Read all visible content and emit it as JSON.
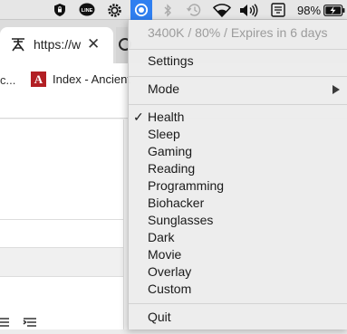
{
  "menubar": {
    "battery_percent": "98%",
    "icons": [
      "lock-icon",
      "line-app-icon",
      "settings-gear-icon",
      "screen-temperature-icon",
      "bluetooth-icon",
      "time-machine-icon",
      "wifi-icon",
      "volume-icon",
      "input-method-icon",
      "battery-charging-icon"
    ]
  },
  "browser": {
    "tab_url": "https://w",
    "tab_close": "✕",
    "bookmark_left_text": "c...",
    "bookmark_letter": "A",
    "bookmark_label": "Index - Ancient"
  },
  "menu": {
    "status": "3400K / 80% / Expires in 6 days",
    "settings": "Settings",
    "mode": "Mode",
    "checkmark": "✓",
    "modes": [
      {
        "label": "Health",
        "checked": true
      },
      {
        "label": "Sleep",
        "checked": false
      },
      {
        "label": "Gaming",
        "checked": false
      },
      {
        "label": "Reading",
        "checked": false
      },
      {
        "label": "Programming",
        "checked": false
      },
      {
        "label": "Biohacker",
        "checked": false
      },
      {
        "label": "Sunglasses",
        "checked": false
      },
      {
        "label": "Dark",
        "checked": false
      },
      {
        "label": "Movie",
        "checked": false
      },
      {
        "label": "Overlay",
        "checked": false
      },
      {
        "label": "Custom",
        "checked": false
      }
    ],
    "quit": "Quit"
  },
  "colors": {
    "menubar_active": "#2f7ff0",
    "bookmark_icon_bg": "#b21f24"
  }
}
